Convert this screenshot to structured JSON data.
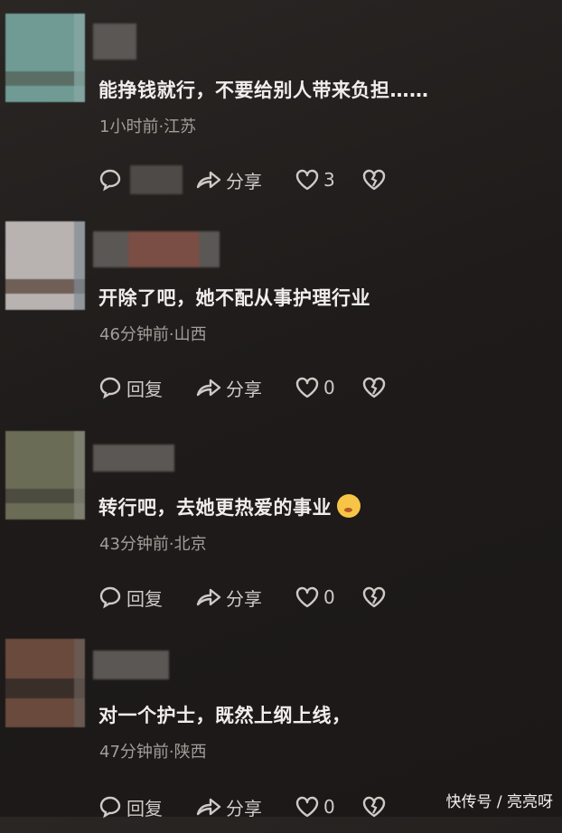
{
  "comments": [
    {
      "text": "能挣钱就行，不要给别人带来负担……",
      "meta": "1小时前·江苏",
      "reply_label": "",
      "share_label": "分享",
      "like_count": "3",
      "avatar_colors": {
        "main": "#6f9b94",
        "band": "#55635a",
        "edge": "#8aa9a6"
      }
    },
    {
      "text": "开除了吧，她不配从事护理行业",
      "meta": "46分钟前·山西",
      "reply_label": "回复",
      "share_label": "分享",
      "like_count": "0",
      "avatar_colors": {
        "main": "#b8b2b0",
        "band": "#5c4a40",
        "edge": "#7f8b95"
      }
    },
    {
      "text": "转行吧，去她更热爱的事业",
      "meta": "43分钟前·北京",
      "reply_label": "回复",
      "share_label": "分享",
      "like_count": "0",
      "avatar_colors": {
        "main": "#6a6c55",
        "band": "#44443a",
        "edge": "#86877a"
      }
    },
    {
      "text": "对一个护士，既然上纲上线，",
      "meta": "47分钟前·陕西",
      "reply_label": "回复",
      "share_label": "分享",
      "like_count": "0",
      "avatar_colors": {
        "main": "#6a4a3c",
        "band": "#2e2724",
        "edge": "#6a5f5a"
      }
    }
  ],
  "watermark": "快传号 / 亮亮呀",
  "icons": [
    "reply-icon",
    "share-icon",
    "heart-icon",
    "broken-heart-icon",
    "face-emoji-icon"
  ]
}
